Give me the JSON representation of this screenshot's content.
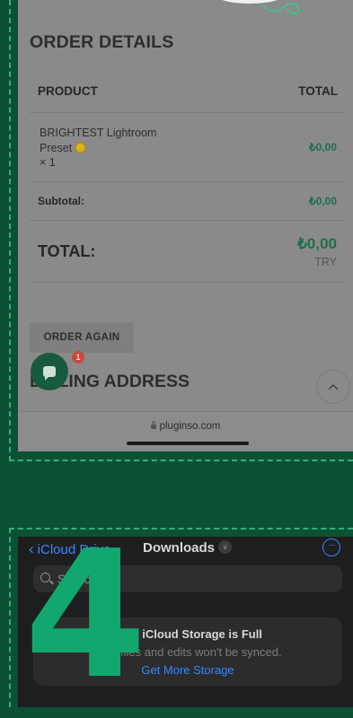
{
  "step": {
    "number": "4"
  },
  "order": {
    "title": "ORDER DETAILS",
    "columns": {
      "product": "PRODUCT",
      "total": "TOTAL"
    },
    "item": {
      "line1": "BRIGHTEST Lightroom",
      "line2": "Preset",
      "qty": "× 1",
      "price": "₺0,00"
    },
    "subtotal": {
      "label": "Subtotal:",
      "value": "₺0,00"
    },
    "total": {
      "label": "TOTAL:",
      "value": "₺0,00",
      "currency": "TRY"
    },
    "order_again": "ORDER AGAIN",
    "billing_heading": "BILLING ADDRESS",
    "chat_badge": "1",
    "url": "pluginso.com"
  },
  "files": {
    "back_label": "iCloud Drive",
    "folder_title": "Downloads",
    "search_placeholder": "Search",
    "banner": {
      "title": "Your iCloud Storage is Full",
      "subtitle": "New files and edits won't be synced.",
      "link": "Get More Storage"
    }
  },
  "colors": {
    "background": "#0c5134",
    "accent_green": "#11a870",
    "price_green": "#1f6e4e",
    "ios_blue": "#3a86ff"
  }
}
